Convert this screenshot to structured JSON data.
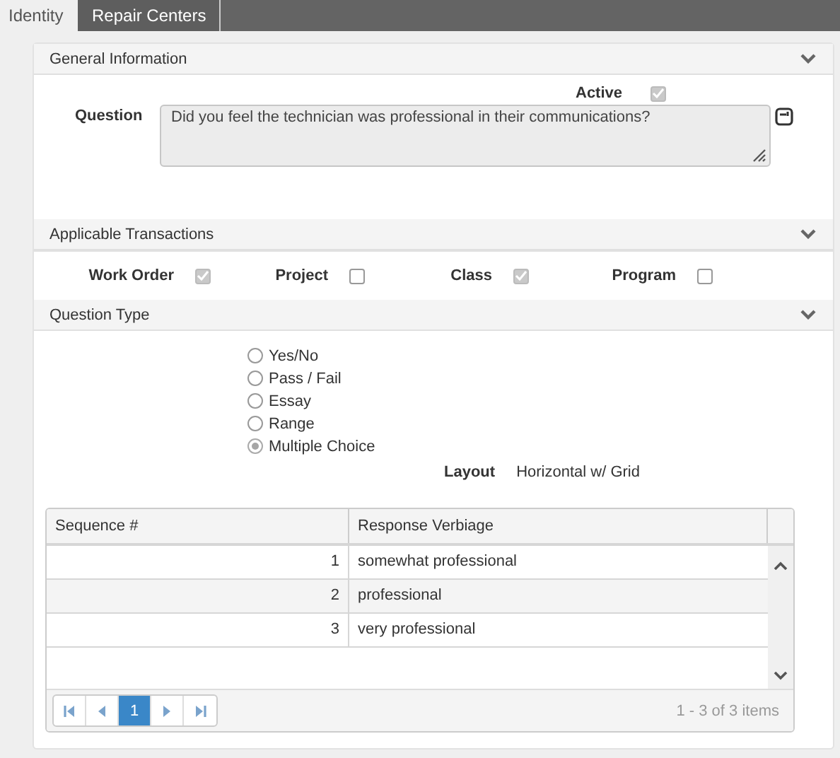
{
  "tabs": [
    {
      "label": "Identity",
      "selected": true
    },
    {
      "label": "Repair Centers",
      "selected": false
    }
  ],
  "general_information": {
    "title": "General Information",
    "active": {
      "label": "Active",
      "checked": true
    },
    "question": {
      "label": "Question",
      "value": "Did you feel the technician was professional in their communications?"
    }
  },
  "applicable_transactions": {
    "title": "Applicable Transactions",
    "items": [
      {
        "label": "Work Order",
        "checked": true
      },
      {
        "label": "Project",
        "checked": false
      },
      {
        "label": "Class",
        "checked": true
      },
      {
        "label": "Program",
        "checked": false
      }
    ]
  },
  "question_type": {
    "title": "Question Type",
    "options": [
      {
        "label": "Yes/No",
        "selected": false
      },
      {
        "label": "Pass / Fail",
        "selected": false
      },
      {
        "label": "Essay",
        "selected": false
      },
      {
        "label": "Range",
        "selected": false
      },
      {
        "label": "Multiple Choice",
        "selected": true
      }
    ],
    "layout": {
      "label": "Layout",
      "value": "Horizontal w/ Grid"
    }
  },
  "grid": {
    "columns": [
      "Sequence #",
      "Response Verbiage"
    ],
    "rows": [
      {
        "sequence": "1",
        "response": "somewhat professional"
      },
      {
        "sequence": "2",
        "response": "professional"
      },
      {
        "sequence": "3",
        "response": "very professional"
      }
    ],
    "pager": {
      "pages": [
        {
          "label": "1",
          "selected": true
        }
      ],
      "summary": "1 - 3 of 3 items"
    }
  }
}
